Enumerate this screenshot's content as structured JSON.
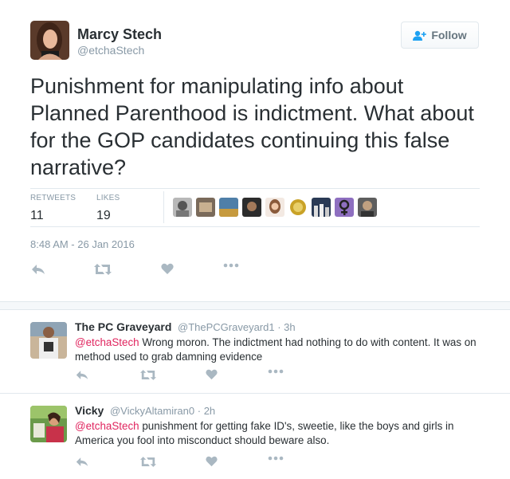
{
  "tweet": {
    "name": "Marcy Stech",
    "handle": "@etchaStech",
    "follow_label": "Follow",
    "text": "Punishment for manipulating info about Planned Parenthood is indictment. What about for the GOP candidates continuing this false narrative?",
    "retweets_label": "RETWEETS",
    "retweets_count": "11",
    "likes_label": "LIKES",
    "likes_count": "19",
    "timestamp": "8:48 AM - 26 Jan 2016",
    "likers_count": 10
  },
  "icons": [
    "reply-icon",
    "retweet-icon",
    "heart-icon",
    "more-icon",
    "follow-user-icon"
  ],
  "colors": {
    "mention": "#e0245e",
    "muted": "#8899a6",
    "text": "#292f33",
    "action_icon": "#aab8c2"
  },
  "replies": [
    {
      "name": "The PC Graveyard",
      "handle": "@ThePCGraveyard1",
      "time": "· 3h",
      "mention": "@etchaStech",
      "text": " Wrong moron.  The indictment had nothing to do with content. It was on method used to grab damning evidence"
    },
    {
      "name": "Vicky",
      "handle": "@VickyAltamiran0",
      "time": "· 2h",
      "mention": "@etchaStech",
      "text": " punishment for getting fake ID's, sweetie, like the boys and girls in America you fool into misconduct should beware also."
    }
  ]
}
